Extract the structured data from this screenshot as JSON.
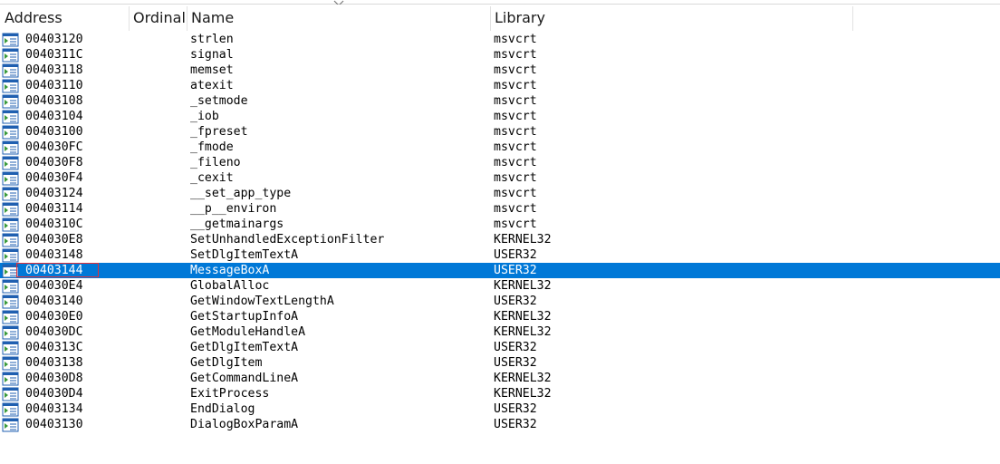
{
  "columns": {
    "address": "Address",
    "ordinal": "Ordinal",
    "name": "Name",
    "library": "Library"
  },
  "icon": "import-function-icon",
  "colors": {
    "selection": "#0078d7",
    "focus_outline": "#e0303a",
    "icon_green": "#3a9a3a",
    "icon_blue": "#1f5fb0"
  },
  "rows": [
    {
      "address": "00403120",
      "ordinal": "",
      "name": "strlen",
      "library": "msvcrt"
    },
    {
      "address": "0040311C",
      "ordinal": "",
      "name": "signal",
      "library": "msvcrt"
    },
    {
      "address": "00403118",
      "ordinal": "",
      "name": "memset",
      "library": "msvcrt"
    },
    {
      "address": "00403110",
      "ordinal": "",
      "name": "atexit",
      "library": "msvcrt"
    },
    {
      "address": "00403108",
      "ordinal": "",
      "name": "_setmode",
      "library": "msvcrt"
    },
    {
      "address": "00403104",
      "ordinal": "",
      "name": "_iob",
      "library": "msvcrt"
    },
    {
      "address": "00403100",
      "ordinal": "",
      "name": "_fpreset",
      "library": "msvcrt"
    },
    {
      "address": "004030FC",
      "ordinal": "",
      "name": "_fmode",
      "library": "msvcrt"
    },
    {
      "address": "004030F8",
      "ordinal": "",
      "name": "_fileno",
      "library": "msvcrt"
    },
    {
      "address": "004030F4",
      "ordinal": "",
      "name": "_cexit",
      "library": "msvcrt"
    },
    {
      "address": "00403124",
      "ordinal": "",
      "name": "__set_app_type",
      "library": "msvcrt"
    },
    {
      "address": "00403114",
      "ordinal": "",
      "name": "__p__environ",
      "library": "msvcrt"
    },
    {
      "address": "0040310C",
      "ordinal": "",
      "name": "__getmainargs",
      "library": "msvcrt"
    },
    {
      "address": "004030E8",
      "ordinal": "",
      "name": "SetUnhandledExceptionFilter",
      "library": "KERNEL32"
    },
    {
      "address": "00403148",
      "ordinal": "",
      "name": "SetDlgItemTextA",
      "library": "USER32"
    },
    {
      "address": "00403144",
      "ordinal": "",
      "name": "MessageBoxA",
      "library": "USER32",
      "selected": true
    },
    {
      "address": "004030E4",
      "ordinal": "",
      "name": "GlobalAlloc",
      "library": "KERNEL32"
    },
    {
      "address": "00403140",
      "ordinal": "",
      "name": "GetWindowTextLengthA",
      "library": "USER32"
    },
    {
      "address": "004030E0",
      "ordinal": "",
      "name": "GetStartupInfoA",
      "library": "KERNEL32"
    },
    {
      "address": "004030DC",
      "ordinal": "",
      "name": "GetModuleHandleA",
      "library": "KERNEL32"
    },
    {
      "address": "0040313C",
      "ordinal": "",
      "name": "GetDlgItemTextA",
      "library": "USER32"
    },
    {
      "address": "00403138",
      "ordinal": "",
      "name": "GetDlgItem",
      "library": "USER32"
    },
    {
      "address": "004030D8",
      "ordinal": "",
      "name": "GetCommandLineA",
      "library": "KERNEL32"
    },
    {
      "address": "004030D4",
      "ordinal": "",
      "name": "ExitProcess",
      "library": "KERNEL32"
    },
    {
      "address": "00403134",
      "ordinal": "",
      "name": "EndDialog",
      "library": "USER32"
    },
    {
      "address": "00403130",
      "ordinal": "",
      "name": "DialogBoxParamA",
      "library": "USER32"
    }
  ]
}
